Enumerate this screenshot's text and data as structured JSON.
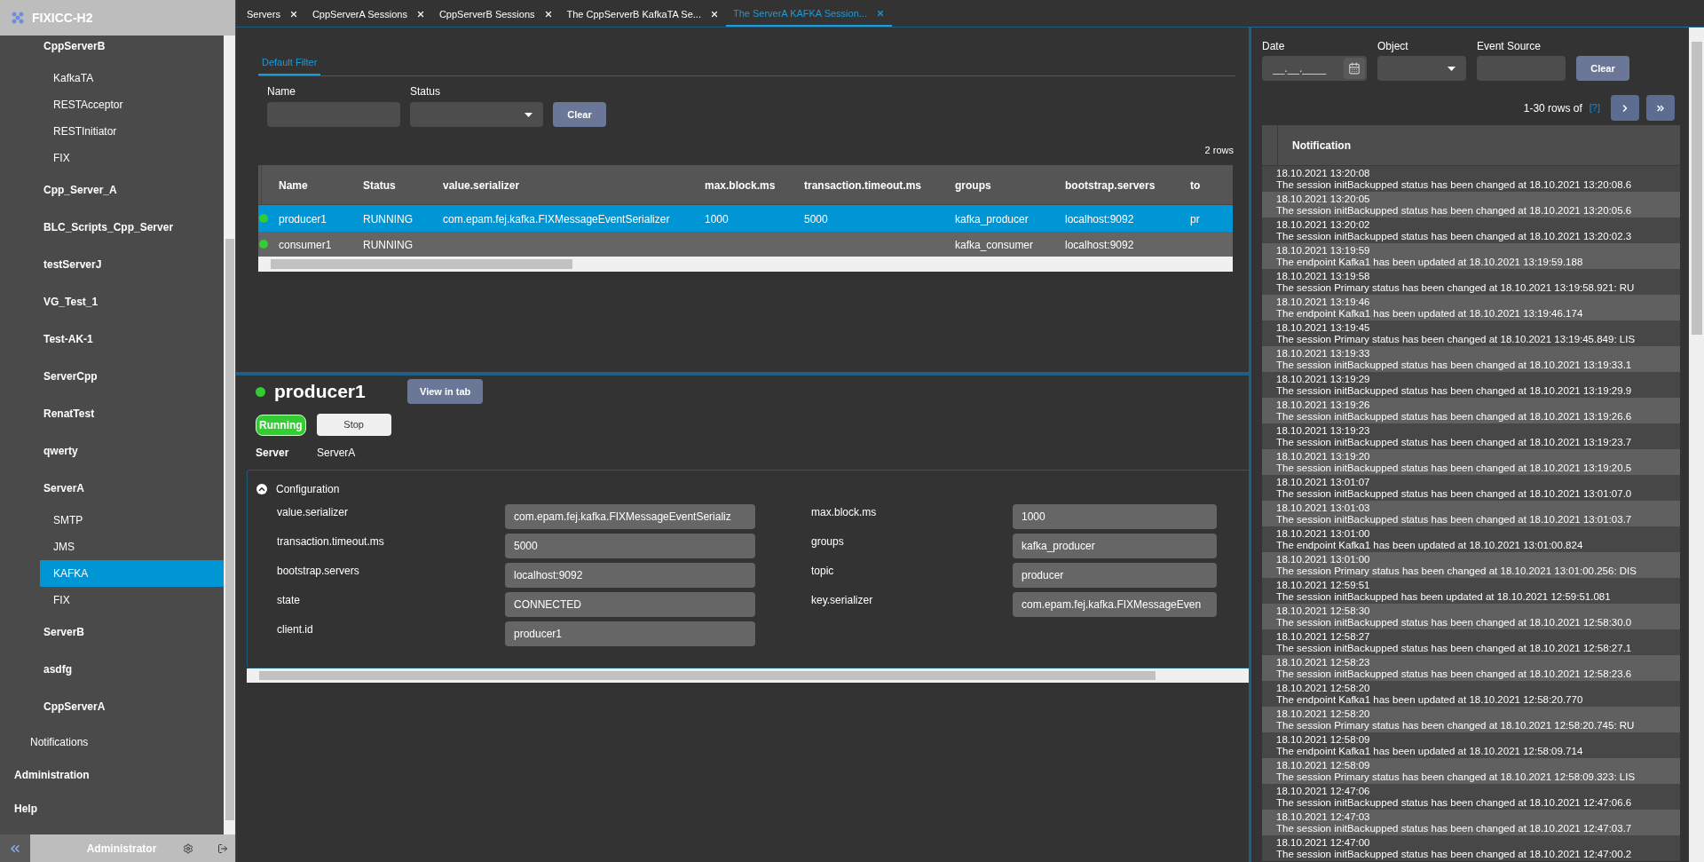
{
  "sidebar": {
    "app_title": "FIXICC-H2",
    "servers": [
      {
        "label": "CppServerB",
        "selected": false,
        "children": [
          {
            "label": "KafkaTA",
            "selected": false
          },
          {
            "label": "RESTAcceptor",
            "selected": false
          },
          {
            "label": "RESTInitiator",
            "selected": false
          },
          {
            "label": "FIX",
            "selected": false
          }
        ]
      },
      {
        "label": "Cpp_Server_A",
        "selected": false
      },
      {
        "label": "BLC_Scripts_Cpp_Server",
        "selected": false
      },
      {
        "label": "testServerJ",
        "selected": false
      },
      {
        "label": "VG_Test_1",
        "selected": false
      },
      {
        "label": "Test-AK-1",
        "selected": false
      },
      {
        "label": "ServerCpp",
        "selected": false
      },
      {
        "label": "RenatTest",
        "selected": false
      },
      {
        "label": "qwerty",
        "selected": false
      },
      {
        "label": "ServerA",
        "selected": false,
        "children": [
          {
            "label": "SMTP",
            "selected": false
          },
          {
            "label": "JMS",
            "selected": false
          },
          {
            "label": "KAFKA",
            "selected": true
          },
          {
            "label": "FIX",
            "selected": false
          }
        ]
      },
      {
        "label": "ServerB",
        "selected": false
      },
      {
        "label": "asdfg",
        "selected": false
      },
      {
        "label": "CppServerA",
        "selected": false
      }
    ],
    "notifications": {
      "label": "Notifications",
      "selected": false
    },
    "sections": [
      {
        "label": "Administration",
        "selected": false
      },
      {
        "label": "Help",
        "selected": false
      }
    ],
    "user": "Administrator"
  },
  "tabs": [
    {
      "label": "Servers",
      "selected": false
    },
    {
      "label": "CppServerA Sessions",
      "selected": false
    },
    {
      "label": "CppServerB Sessions",
      "selected": false
    },
    {
      "label": "The CppServerB KafkaTA Se...",
      "selected": false
    },
    {
      "label": "The ServerA KAFKA Session...",
      "selected": true
    }
  ],
  "filter": {
    "tabs": [
      {
        "label": "Default Filter",
        "selected": true
      }
    ],
    "fields": [
      {
        "label": "Name",
        "kind": "text"
      },
      {
        "label": "Status",
        "kind": "select"
      }
    ],
    "clear_button": "Clear"
  },
  "sessions_table": {
    "row_count": "2 rows",
    "columns": [
      "Name",
      "Status",
      "value.serializer",
      "max.block.ms",
      "transaction.timeout.ms",
      "groups",
      "bootstrap.servers",
      "to"
    ],
    "rows": [
      {
        "selected": true,
        "cells": [
          "producer1",
          "RUNNING",
          "com.epam.fej.kafka.FIXMessageEventSerializer",
          "1000",
          "5000",
          "kafka_producer",
          "localhost:9092",
          "pr"
        ]
      },
      {
        "selected": false,
        "cells": [
          "consumer1",
          "RUNNING",
          "",
          "",
          "",
          "kafka_consumer",
          "localhost:9092",
          ""
        ]
      }
    ]
  },
  "detail": {
    "title": "producer1",
    "view_button": "View in tab",
    "state_badge": "Running",
    "stop_button": "Stop",
    "server_label": "Server",
    "server_value": "ServerA",
    "configuration": {
      "title": "Configuration",
      "expanded": true,
      "left": [
        {
          "label": "value.serializer",
          "value": "com.epam.fej.kafka.FIXMessageEventSerializ"
        },
        {
          "label": "transaction.timeout.ms",
          "value": "5000"
        },
        {
          "label": "bootstrap.servers",
          "value": "localhost:9092"
        },
        {
          "label": "state",
          "value": "CONNECTED"
        },
        {
          "label": "client.id",
          "value": "producer1"
        }
      ],
      "right": [
        {
          "label": "max.block.ms",
          "value": "1000"
        },
        {
          "label": "groups",
          "value": "kafka_producer"
        },
        {
          "label": "topic",
          "value": "producer"
        },
        {
          "label": "key.serializer",
          "value": "com.epam.fej.kafka.FIXMessageEven"
        }
      ]
    }
  },
  "events": {
    "filters": [
      {
        "label": "Date",
        "kind": "date",
        "placeholder": "__.__.____"
      },
      {
        "label": "Object",
        "kind": "select"
      },
      {
        "label": "Event Source",
        "kind": "text"
      }
    ],
    "clear_button": "Clear",
    "pager": {
      "range": "1-30 rows of",
      "total": "[?]"
    },
    "column": "Notification",
    "rows": [
      {
        "time": "18.10.2021 13:20:08",
        "message": "The session initBackupped status has been changed at 18.10.2021 13:20:08.6"
      },
      {
        "time": "18.10.2021 13:20:05",
        "message": "The session initBackupped status has been changed at 18.10.2021 13:20:05.6"
      },
      {
        "time": "18.10.2021 13:20:02",
        "message": "The session initBackupped status has been changed at 18.10.2021 13:20:02.3"
      },
      {
        "time": "18.10.2021 13:19:59",
        "message": "The endpoint Kafka1 has been updated at 18.10.2021 13:19:59.188"
      },
      {
        "time": "18.10.2021 13:19:58",
        "message": "The session Primary status has been changed at 18.10.2021 13:19:58.921: RU"
      },
      {
        "time": "18.10.2021 13:19:46",
        "message": "The endpoint Kafka1 has been updated at 18.10.2021 13:19:46.174"
      },
      {
        "time": "18.10.2021 13:19:45",
        "message": "The session Primary status has been changed at 18.10.2021 13:19:45.849: LIS"
      },
      {
        "time": "18.10.2021 13:19:33",
        "message": "The session initBackupped status has been changed at 18.10.2021 13:19:33.1"
      },
      {
        "time": "18.10.2021 13:19:29",
        "message": "The session initBackupped status has been changed at 18.10.2021 13:19:29.9"
      },
      {
        "time": "18.10.2021 13:19:26",
        "message": "The session initBackupped status has been changed at 18.10.2021 13:19:26.6"
      },
      {
        "time": "18.10.2021 13:19:23",
        "message": "The session initBackupped status has been changed at 18.10.2021 13:19:23.7"
      },
      {
        "time": "18.10.2021 13:19:20",
        "message": "The session initBackupped status has been changed at 18.10.2021 13:19:20.5"
      },
      {
        "time": "18.10.2021 13:01:07",
        "message": "The session initBackupped status has been changed at 18.10.2021 13:01:07.0"
      },
      {
        "time": "18.10.2021 13:01:03",
        "message": "The session initBackupped status has been changed at 18.10.2021 13:01:03.7"
      },
      {
        "time": "18.10.2021 13:01:00",
        "message": "The endpoint Kafka1 has been updated at 18.10.2021 13:01:00.824"
      },
      {
        "time": "18.10.2021 13:01:00",
        "message": "The session Primary status has been changed at 18.10.2021 13:01:00.256: DIS"
      },
      {
        "time": "18.10.2021 12:59:51",
        "message": "The session initBackupped has been updated at 18.10.2021 12:59:51.081"
      },
      {
        "time": "18.10.2021 12:58:30",
        "message": "The session initBackupped status has been changed at 18.10.2021 12:58:30.0"
      },
      {
        "time": "18.10.2021 12:58:27",
        "message": "The session initBackupped status has been changed at 18.10.2021 12:58:27.1"
      },
      {
        "time": "18.10.2021 12:58:23",
        "message": "The session initBackupped status has been changed at 18.10.2021 12:58:23.6"
      },
      {
        "time": "18.10.2021 12:58:20",
        "message": "The endpoint Kafka1 has been updated at 18.10.2021 12:58:20.770"
      },
      {
        "time": "18.10.2021 12:58:20",
        "message": "The session Primary status has been changed at 18.10.2021 12:58:20.745: RU"
      },
      {
        "time": "18.10.2021 12:58:09",
        "message": "The endpoint Kafka1 has been updated at 18.10.2021 12:58:09.714"
      },
      {
        "time": "18.10.2021 12:58:09",
        "message": "The session Primary status has been changed at 18.10.2021 12:58:09.323: LIS"
      },
      {
        "time": "18.10.2021 12:47:06",
        "message": "The session initBackupped status has been changed at 18.10.2021 12:47:06.6"
      },
      {
        "time": "18.10.2021 12:47:03",
        "message": "The session initBackupped status has been changed at 18.10.2021 12:47:03.7"
      },
      {
        "time": "18.10.2021 12:47:00",
        "message": "The session initBackupped status has been changed at 18.10.2021 12:47:00.2"
      }
    ]
  }
}
